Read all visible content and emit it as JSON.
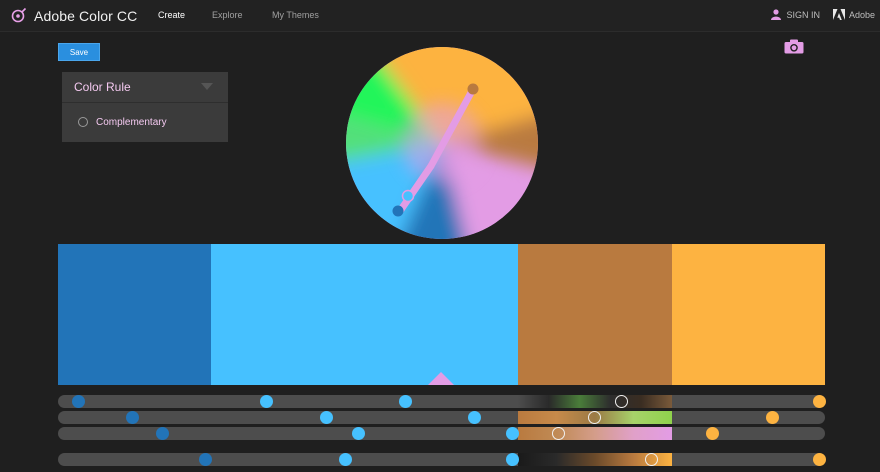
{
  "app": {
    "title": "Adobe Color CC",
    "nav": [
      "Create",
      "Explore",
      "My Themes"
    ],
    "sign_in": "SIGN IN",
    "adobe": "Adobe"
  },
  "toolbar": {
    "save_label": "Save"
  },
  "color_rule": {
    "header": "Color Rule",
    "option": "Complementary"
  },
  "theme": {
    "swatches": [
      {
        "color": "#2274b8"
      },
      {
        "color": "#46c1ff"
      },
      {
        "color": "#b97a3f"
      },
      {
        "color": "#fdb341"
      }
    ],
    "selected_index": 1
  },
  "icons": {
    "logo": "color-wheel-icon",
    "user": "user-icon",
    "adobe": "adobe-logo-icon",
    "chevron": "chevron-down-icon",
    "camera": "camera-icon"
  },
  "colors": {
    "accent": "#2a8fdf",
    "highlight": "#e39ce5",
    "background": "#1f1f1f"
  }
}
